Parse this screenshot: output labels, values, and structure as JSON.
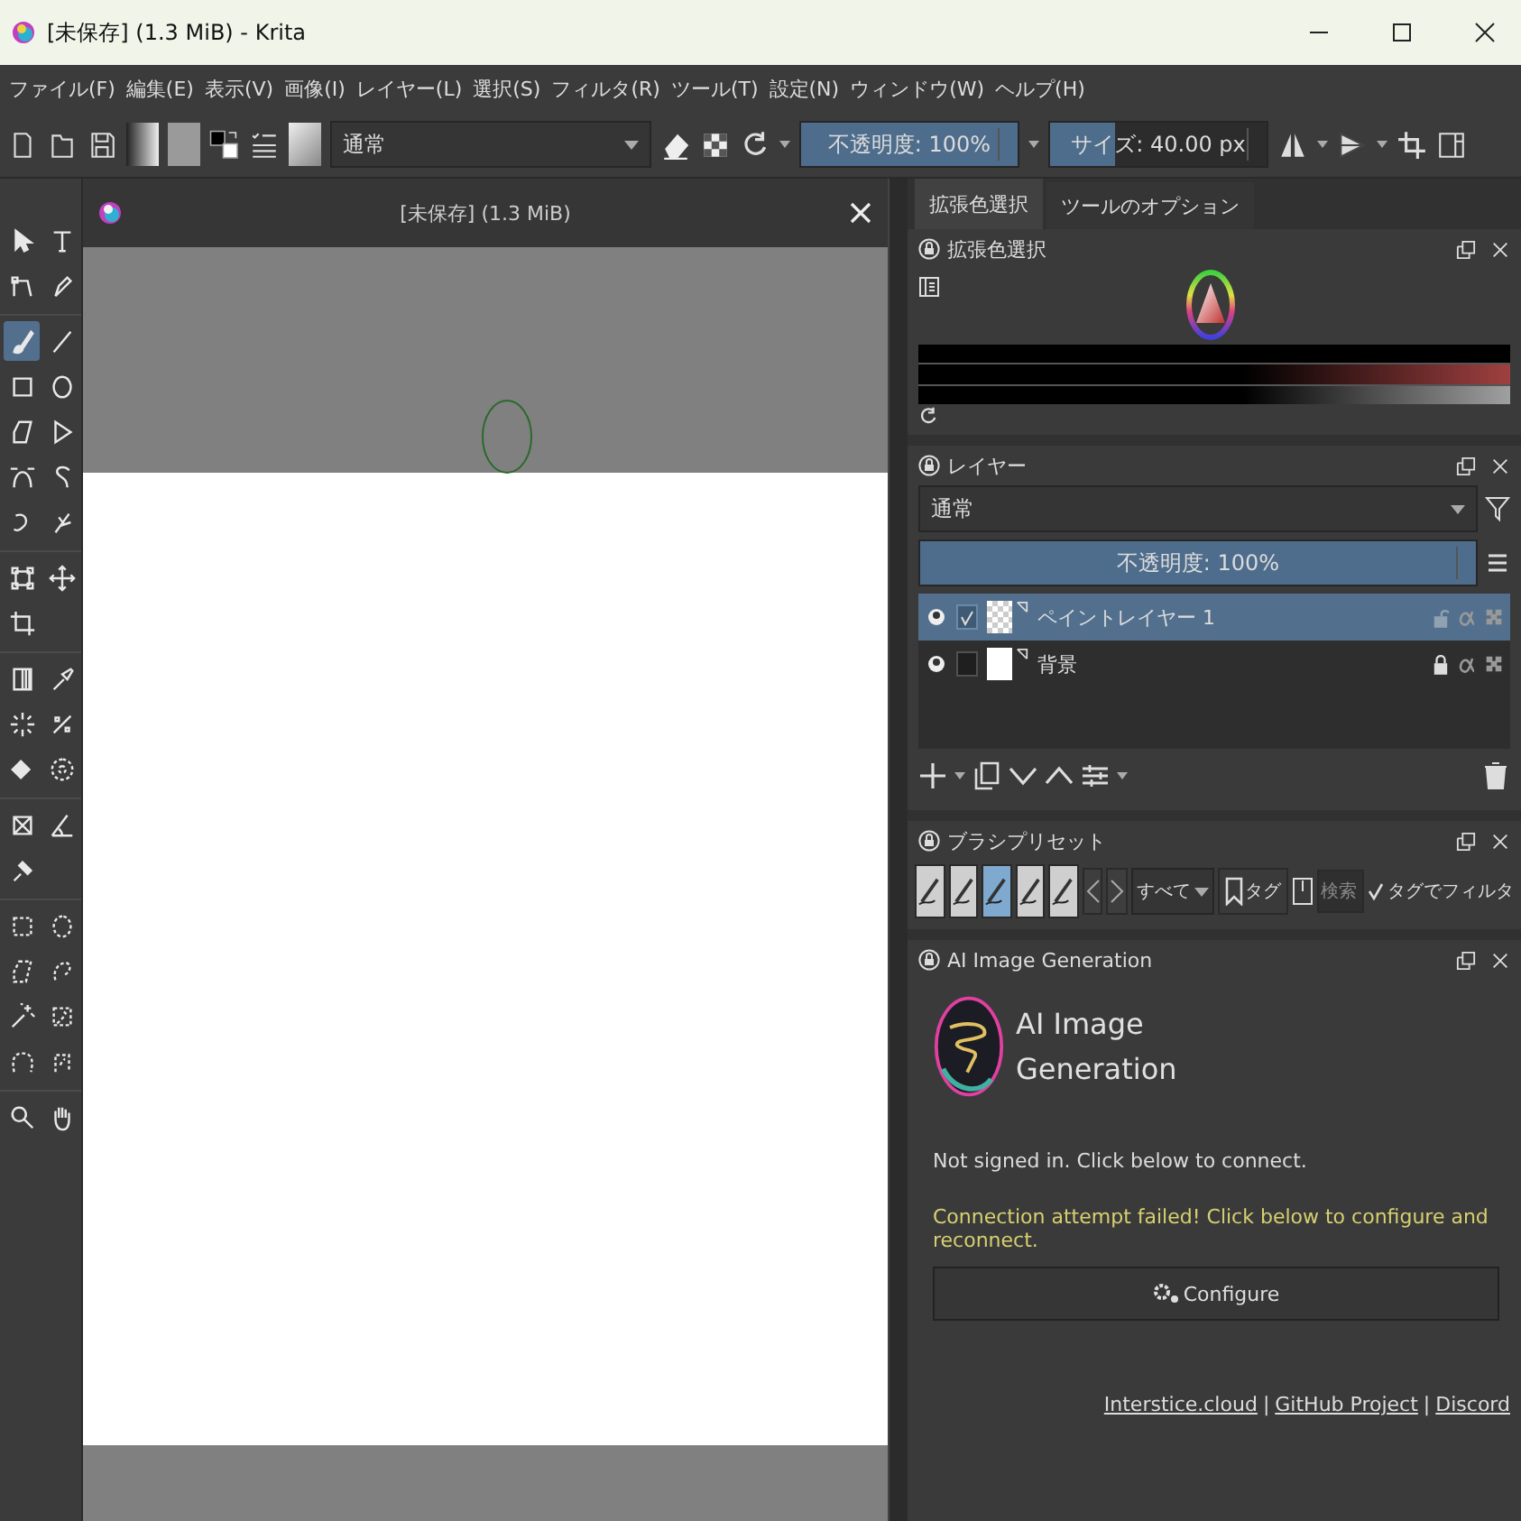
{
  "window": {
    "title": "[未保存]  (1.3 MiB)  - Krita"
  },
  "menu": [
    "ファイル(F)",
    "編集(E)",
    "表示(V)",
    "画像(I)",
    "レイヤー(L)",
    "選択(S)",
    "フィルタ(R)",
    "ツール(T)",
    "設定(N)",
    "ウィンドウ(W)",
    "ヘルプ(H)"
  ],
  "toolbar": {
    "blend_mode": "通常",
    "opacity": {
      "text": "不透明度: 100%",
      "level": 1
    },
    "size": {
      "text": "サイズ: 40.00 px",
      "level": 0.3
    }
  },
  "toolbox": {
    "groups": [
      {
        "tools": [
          {
            "kind": "pointer",
            "selected": false
          },
          {
            "kind": "text",
            "selected": false
          },
          {
            "kind": "shape_edit",
            "selected": false
          },
          {
            "kind": "calligraphy",
            "selected": false
          }
        ]
      },
      {
        "tools": [
          {
            "kind": "brush",
            "selected": true
          },
          {
            "kind": "line",
            "selected": false
          },
          {
            "kind": "rectangle",
            "selected": false
          },
          {
            "kind": "ellipse",
            "selected": false
          },
          {
            "kind": "polygon",
            "selected": false
          },
          {
            "kind": "polyline",
            "selected": false
          },
          {
            "kind": "bezier",
            "selected": false
          },
          {
            "kind": "freehand_path",
            "selected": false
          },
          {
            "kind": "dynamic",
            "selected": false
          },
          {
            "kind": "multibrush",
            "selected": false
          }
        ]
      },
      {
        "tools": [
          {
            "kind": "transform",
            "selected": false
          },
          {
            "kind": "move",
            "selected": false
          },
          {
            "kind": "crop",
            "selected": false
          }
        ]
      },
      {
        "tools": [
          {
            "kind": "gradient",
            "selected": false
          },
          {
            "kind": "picker",
            "selected": false
          },
          {
            "kind": "smart_patch",
            "selected": false
          },
          {
            "kind": "colorize",
            "selected": false
          },
          {
            "kind": "fill",
            "selected": false
          },
          {
            "kind": "enclose",
            "selected": false
          }
        ]
      },
      {
        "tools": [
          {
            "kind": "assistant",
            "selected": false
          },
          {
            "kind": "measure",
            "selected": false
          },
          {
            "kind": "reference",
            "selected": false
          }
        ]
      },
      {
        "tools": [
          {
            "kind": "rect_sel",
            "selected": false
          },
          {
            "kind": "ellipse_sel",
            "selected": false
          },
          {
            "kind": "polygon_sel",
            "selected": false
          },
          {
            "kind": "freehand_sel",
            "selected": false
          },
          {
            "kind": "contiguous_sel",
            "selected": false
          },
          {
            "kind": "similar_sel",
            "selected": false
          },
          {
            "kind": "bezier_sel",
            "selected": false
          },
          {
            "kind": "magnetic_sel",
            "selected": false
          }
        ]
      },
      {
        "tools": [
          {
            "kind": "zoom",
            "selected": false
          },
          {
            "kind": "pan",
            "selected": false
          }
        ]
      }
    ]
  },
  "document": {
    "title": "[未保存]  (1.3 MiB)"
  },
  "dock_tabs": [
    {
      "label": "拡張色選択",
      "selected": true
    },
    {
      "label": "ツールのオプション",
      "selected": false
    }
  ],
  "color_panel": {
    "title": "拡張色選択"
  },
  "layers_panel": {
    "title": "レイヤー",
    "blend_mode": "通常",
    "opacity": {
      "text": "不透明度: 100%",
      "level": 1
    },
    "layers": [
      {
        "name": "ペイントレイヤー 1",
        "selected": true,
        "checked": true,
        "locked": false,
        "kind": "transparent"
      },
      {
        "name": "背景",
        "selected": false,
        "checked": false,
        "locked": true,
        "kind": "opaque"
      }
    ]
  },
  "brush_presets": {
    "title": "ブラシプリセット",
    "presets": [
      {
        "selected": false
      },
      {
        "selected": false
      },
      {
        "selected": true
      },
      {
        "selected": false
      },
      {
        "selected": false
      }
    ],
    "filter": "すべて",
    "tag": "タグ",
    "search_placeholder": "検索",
    "tag_filter": {
      "label": "タグでフィルタ",
      "checked": true
    }
  },
  "ai_panel": {
    "title": "AI Image Generation",
    "heading_lines": [
      "AI Image",
      "Generation"
    ],
    "status": "Not signed in. Click below to connect.",
    "error": "Connection attempt failed! Click below to configure and reconnect.",
    "configure_button": "Configure",
    "footer": [
      {
        "kind": "link",
        "text": "Interstice.cloud"
      },
      {
        "kind": "separator",
        "text": "|"
      },
      {
        "kind": "link",
        "text": "GitHub Project"
      },
      {
        "kind": "separator",
        "text": "|"
      },
      {
        "kind": "link",
        "text": "Discord"
      }
    ]
  }
}
